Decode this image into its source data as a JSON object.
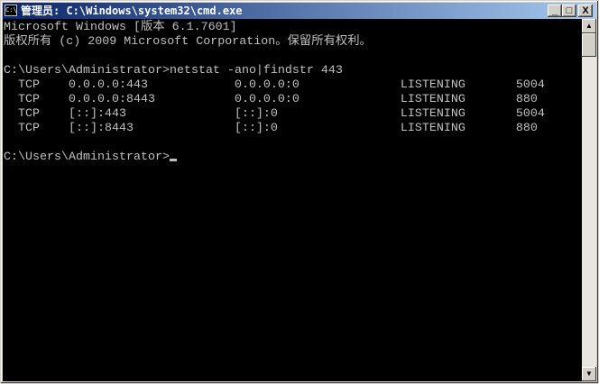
{
  "window": {
    "title": "管理员: C:\\Windows\\system32\\cmd.exe",
    "icon_label": "C:\\"
  },
  "controls": {
    "minimize": "_",
    "maximize": "□",
    "close": "X"
  },
  "console": {
    "lines": [
      "Microsoft Windows [版本 6.1.7601]",
      "版权所有 (c) 2009 Microsoft Corporation。保留所有权利。",
      "",
      "C:\\Users\\Administrator>netstat -ano|findstr 443",
      "  TCP    0.0.0.0:443            0.0.0.0:0              LISTENING       5004",
      "  TCP    0.0.0.0:8443           0.0.0.0:0              LISTENING       880",
      "  TCP    [::]:443               [::]:0                 LISTENING       5004",
      "  TCP    [::]:8443              [::]:0                 LISTENING       880",
      "",
      "C:\\Users\\Administrator>"
    ]
  },
  "scrollbar": {
    "up": "▲",
    "down": "▼"
  }
}
